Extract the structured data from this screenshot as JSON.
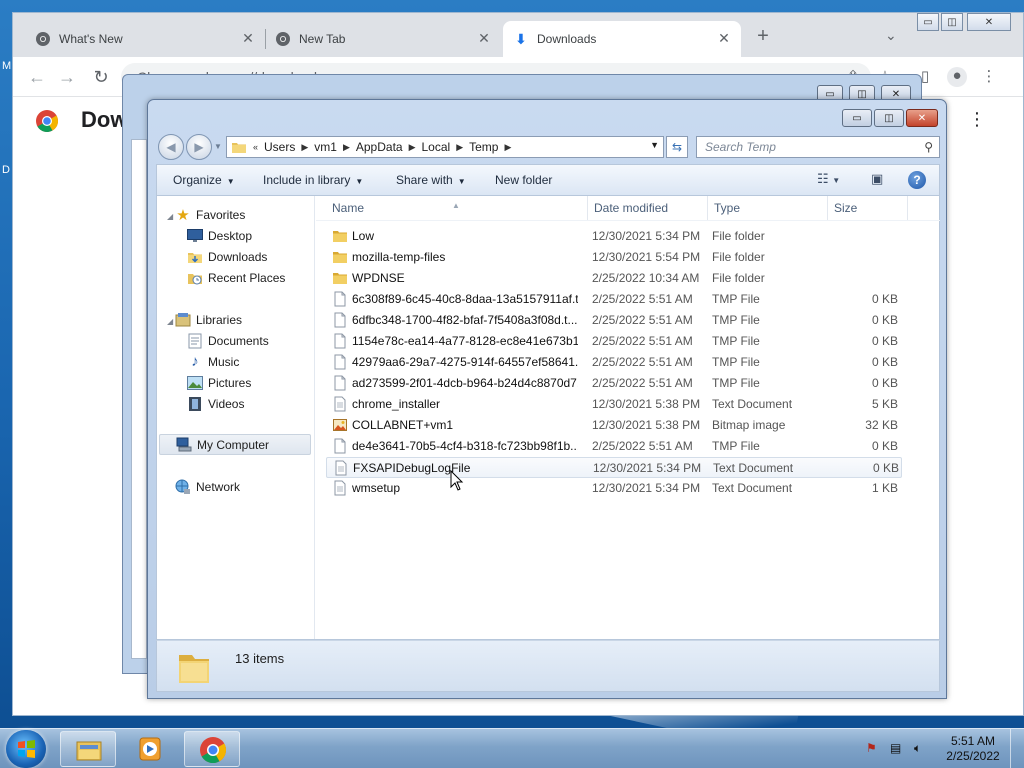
{
  "chrome": {
    "tabs": [
      {
        "label": "What's New",
        "icon": "chrome-logo-icon"
      },
      {
        "label": "New Tab",
        "icon": "chrome-logo-icon"
      },
      {
        "label": "Downloads",
        "icon": "download-icon"
      }
    ],
    "omnibox": {
      "site": "Chrome",
      "url": "chrome://downloads"
    },
    "page_title": "Downloads"
  },
  "explorer": {
    "breadcrumb": [
      "Users",
      "vm1",
      "AppData",
      "Local",
      "Temp"
    ],
    "search_placeholder": "Search Temp",
    "commands": {
      "organize": "Organize",
      "include_in_library": "Include in library",
      "share_with": "Share with",
      "new_folder": "New folder"
    },
    "nav": {
      "favorites": "Favorites",
      "desktop": "Desktop",
      "downloads": "Downloads",
      "recent_places": "Recent Places",
      "libraries": "Libraries",
      "documents": "Documents",
      "music": "Music",
      "pictures": "Pictures",
      "videos": "Videos",
      "my_computer": "My Computer",
      "network": "Network"
    },
    "columns": {
      "name": "Name",
      "date": "Date modified",
      "type": "Type",
      "size": "Size"
    },
    "files": [
      {
        "name": "Low",
        "date": "12/30/2021 5:34 PM",
        "type": "File folder",
        "size": "",
        "icon": "folder"
      },
      {
        "name": "mozilla-temp-files",
        "date": "12/30/2021 5:54 PM",
        "type": "File folder",
        "size": "",
        "icon": "folder"
      },
      {
        "name": "WPDNSE",
        "date": "2/25/2022 10:34 AM",
        "type": "File folder",
        "size": "",
        "icon": "folder"
      },
      {
        "name": "6c308f89-6c45-40c8-8daa-13a5157911af.t...",
        "date": "2/25/2022 5:51 AM",
        "type": "TMP File",
        "size": "0 KB",
        "icon": "file"
      },
      {
        "name": "6dfbc348-1700-4f82-bfaf-7f5408a3f08d.t...",
        "date": "2/25/2022 5:51 AM",
        "type": "TMP File",
        "size": "0 KB",
        "icon": "file"
      },
      {
        "name": "1154e78c-ea14-4a77-8128-ec8e41e673b1....",
        "date": "2/25/2022 5:51 AM",
        "type": "TMP File",
        "size": "0 KB",
        "icon": "file"
      },
      {
        "name": "42979aa6-29a7-4275-914f-64557ef58641.t...",
        "date": "2/25/2022 5:51 AM",
        "type": "TMP File",
        "size": "0 KB",
        "icon": "file"
      },
      {
        "name": "ad273599-2f01-4dcb-b964-b24d4c8870d7...",
        "date": "2/25/2022 5:51 AM",
        "type": "TMP File",
        "size": "0 KB",
        "icon": "file"
      },
      {
        "name": "chrome_installer",
        "date": "12/30/2021 5:38 PM",
        "type": "Text Document",
        "size": "5 KB",
        "icon": "text"
      },
      {
        "name": "COLLABNET+vm1",
        "date": "12/30/2021 5:38 PM",
        "type": "Bitmap image",
        "size": "32 KB",
        "icon": "bitmap"
      },
      {
        "name": "de4e3641-70b5-4cf4-b318-fc723bb98f1b....",
        "date": "2/25/2022 5:51 AM",
        "type": "TMP File",
        "size": "0 KB",
        "icon": "file"
      },
      {
        "name": "FXSAPIDebugLogFile",
        "date": "12/30/2021 5:34 PM",
        "type": "Text Document",
        "size": "0 KB",
        "icon": "text"
      },
      {
        "name": "wmsetup",
        "date": "12/30/2021 5:34 PM",
        "type": "Text Document",
        "size": "1 KB",
        "icon": "text"
      }
    ],
    "status": "13 items"
  },
  "taskbar": {
    "clock_time": "5:51 AM",
    "clock_date": "2/25/2022"
  },
  "colors": {
    "desktop_blue": "#1a66b0",
    "explorer_frame": "#c9daf0",
    "chrome_tabstrip": "#dee1e6",
    "close_red": "#c3432b"
  }
}
